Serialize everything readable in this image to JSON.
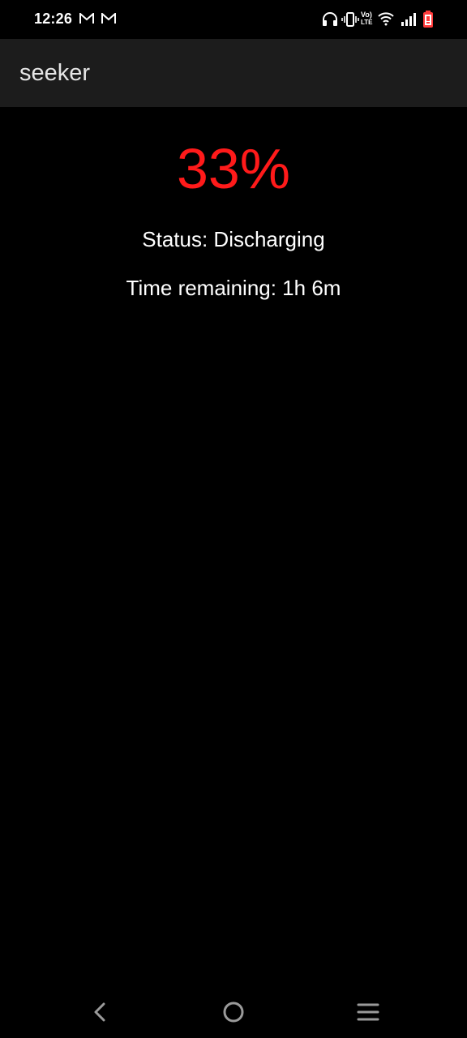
{
  "status_bar": {
    "time": "12:26",
    "notification_icons": [
      "gmail-icon",
      "gmail-icon"
    ],
    "system_icons": [
      "headphones-icon",
      "vibrate-icon",
      "volte-lte-icon",
      "wifi-icon",
      "signal-icon",
      "battery-low-icon"
    ],
    "volte_label_top": "Vo)",
    "volte_label_bottom": "LTE"
  },
  "app_bar": {
    "title": "seeker"
  },
  "battery": {
    "percent": "33%",
    "status": "Status: Discharging",
    "time_remaining": "Time remaining: 1h 6m",
    "accent_color": "#ff1a1a"
  },
  "nav_bar": {
    "buttons": [
      "back-icon",
      "home-icon",
      "menu-icon"
    ]
  }
}
